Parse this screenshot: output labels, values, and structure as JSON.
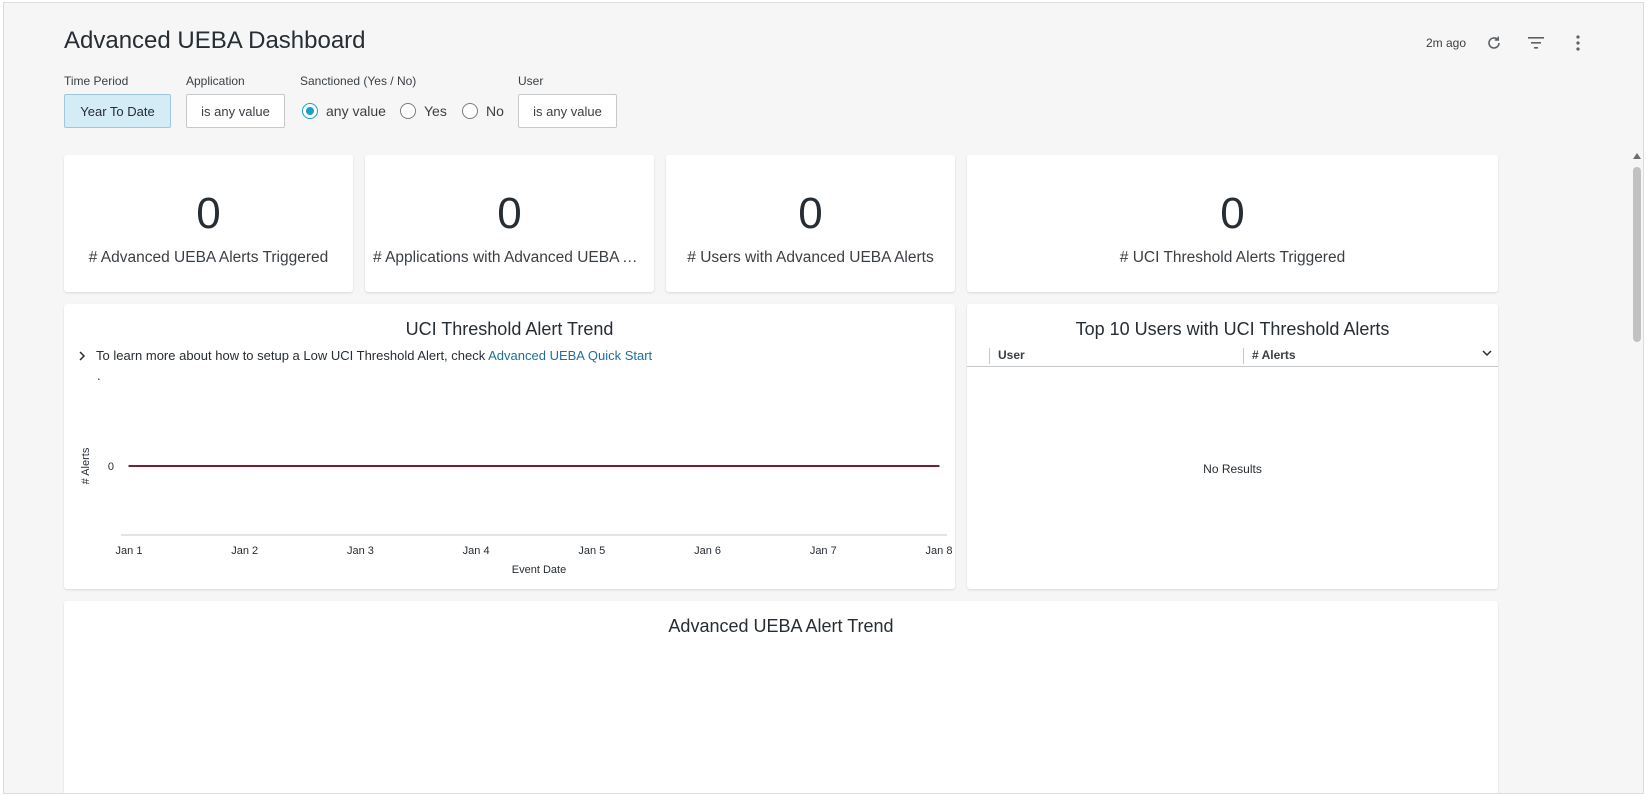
{
  "header": {
    "title": "Advanced UEBA Dashboard",
    "updated": "2m ago",
    "icons": [
      "refresh-icon",
      "filter-icon",
      "more-vertical-icon"
    ]
  },
  "filters": {
    "time_period": {
      "label": "Time Period",
      "value": "Year To Date"
    },
    "application": {
      "label": "Application",
      "value": "is any value"
    },
    "sanctioned": {
      "label": "Sanctioned (Yes / No)",
      "options": [
        "any value",
        "Yes",
        "No"
      ],
      "selected": "any value"
    },
    "user": {
      "label": "User",
      "value": "is any value"
    }
  },
  "kpis": [
    {
      "value": "0",
      "label": "# Advanced UEBA Alerts Triggered"
    },
    {
      "value": "0",
      "label": "# Applications with Advanced UEBA Alerts"
    },
    {
      "value": "0",
      "label": "# Users with Advanced UEBA Alerts"
    },
    {
      "value": "0",
      "label": "# UCI Threshold Alerts Triggered"
    }
  ],
  "uci_trend": {
    "title": "UCI Threshold Alert Trend",
    "note_text": "To learn more about how to setup a Low UCI Threshold Alert, check ",
    "note_link": "Advanced UEBA Quick Start",
    "note_dot": "."
  },
  "chart_data": {
    "type": "line",
    "title": "UCI Threshold Alert Trend",
    "xlabel": "Event Date",
    "ylabel": "# Alerts",
    "x": [
      "Jan 1",
      "Jan 2",
      "Jan 3",
      "Jan 4",
      "Jan 5",
      "Jan 6",
      "Jan 7",
      "Jan 8"
    ],
    "y_ticks": [
      0
    ],
    "series": [
      {
        "values": [
          0,
          0,
          0,
          0,
          0,
          0,
          0,
          0
        ],
        "color": "#7a1f2b"
      }
    ]
  },
  "top_users": {
    "title": "Top 10 Users with UCI Threshold Alerts",
    "columns": [
      "User",
      "# Alerts"
    ],
    "empty": "No Results"
  },
  "ueba_trend": {
    "title": "Advanced UEBA Alert Trend"
  }
}
